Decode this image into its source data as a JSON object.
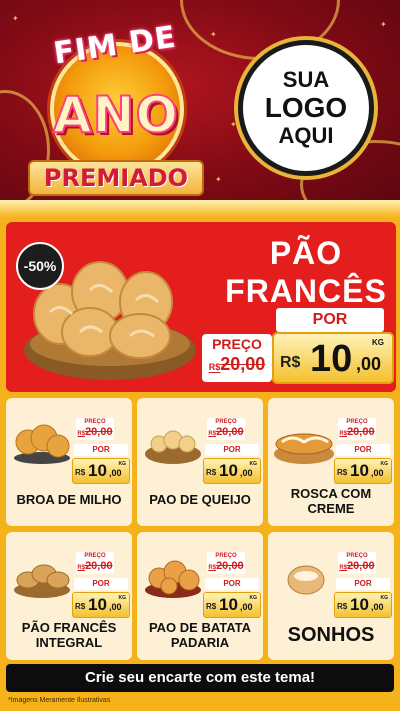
{
  "header": {
    "badge_top": "FIM DE",
    "badge_mid": "ANO",
    "badge_bottom": "PREMIADO",
    "logo_line1": "SUA",
    "logo_line2": "LOGO",
    "logo_line3": "AQUI"
  },
  "hero": {
    "discount": "-50%",
    "title_line1": "PÃO",
    "title_line2": "FRANCÊS",
    "por_label": "POR",
    "preco_label": "PREÇO",
    "old_currency": "R$",
    "old_price": "20,00",
    "new_currency": "R$",
    "new_int": "10",
    "new_cents": ",00",
    "unit": "KG"
  },
  "cards": [
    {
      "name": "BROA DE MILHO",
      "preco_label": "PREÇO",
      "old_currency": "R$",
      "old_price": "20,00",
      "por_label": "POR",
      "new_currency": "R$",
      "new_int": "10",
      "new_cents": ",00",
      "unit": "KG"
    },
    {
      "name": "PAO DE QUEIJO",
      "preco_label": "PREÇO",
      "old_currency": "R$",
      "old_price": "20,00",
      "por_label": "POR",
      "new_currency": "R$",
      "new_int": "10",
      "new_cents": ",00",
      "unit": "KG"
    },
    {
      "name": "ROSCA COM CREME",
      "preco_label": "PREÇO",
      "old_currency": "R$",
      "old_price": "20,00",
      "por_label": "POR",
      "new_currency": "R$",
      "new_int": "10",
      "new_cents": ",00",
      "unit": "KG"
    },
    {
      "name": "PÃO FRANCÊS INTEGRAL",
      "preco_label": "PREÇO",
      "old_currency": "R$",
      "old_price": "20,00",
      "por_label": "POR",
      "new_currency": "R$",
      "new_int": "10",
      "new_cents": ",00",
      "unit": "KG"
    },
    {
      "name": "PAO DE BATATA PADARIA",
      "preco_label": "PREÇO",
      "old_currency": "R$",
      "old_price": "20,00",
      "por_label": "POR",
      "new_currency": "R$",
      "new_int": "10",
      "new_cents": ",00",
      "unit": "KG"
    },
    {
      "name": "SONHOS",
      "preco_label": "PREÇO",
      "old_currency": "R$",
      "old_price": "20,00",
      "por_label": "POR",
      "new_currency": "R$",
      "new_int": "10",
      "new_cents": ",00",
      "unit": "KG"
    }
  ],
  "cta": {
    "label": "Crie seu encarte com este tema!"
  },
  "footnote": "*Imagens Meramente Ilustrativas",
  "colors": {
    "header_red": "#7d0a14",
    "hero_red": "#e41d1d",
    "gold": "#f6b21b",
    "card_bg": "#fdf0d4"
  },
  "icons": [
    "bread-basket-icon",
    "broa-icon",
    "pao-de-queijo-icon",
    "rosca-icon",
    "pao-integral-icon",
    "pao-batata-icon",
    "sonho-icon"
  ]
}
